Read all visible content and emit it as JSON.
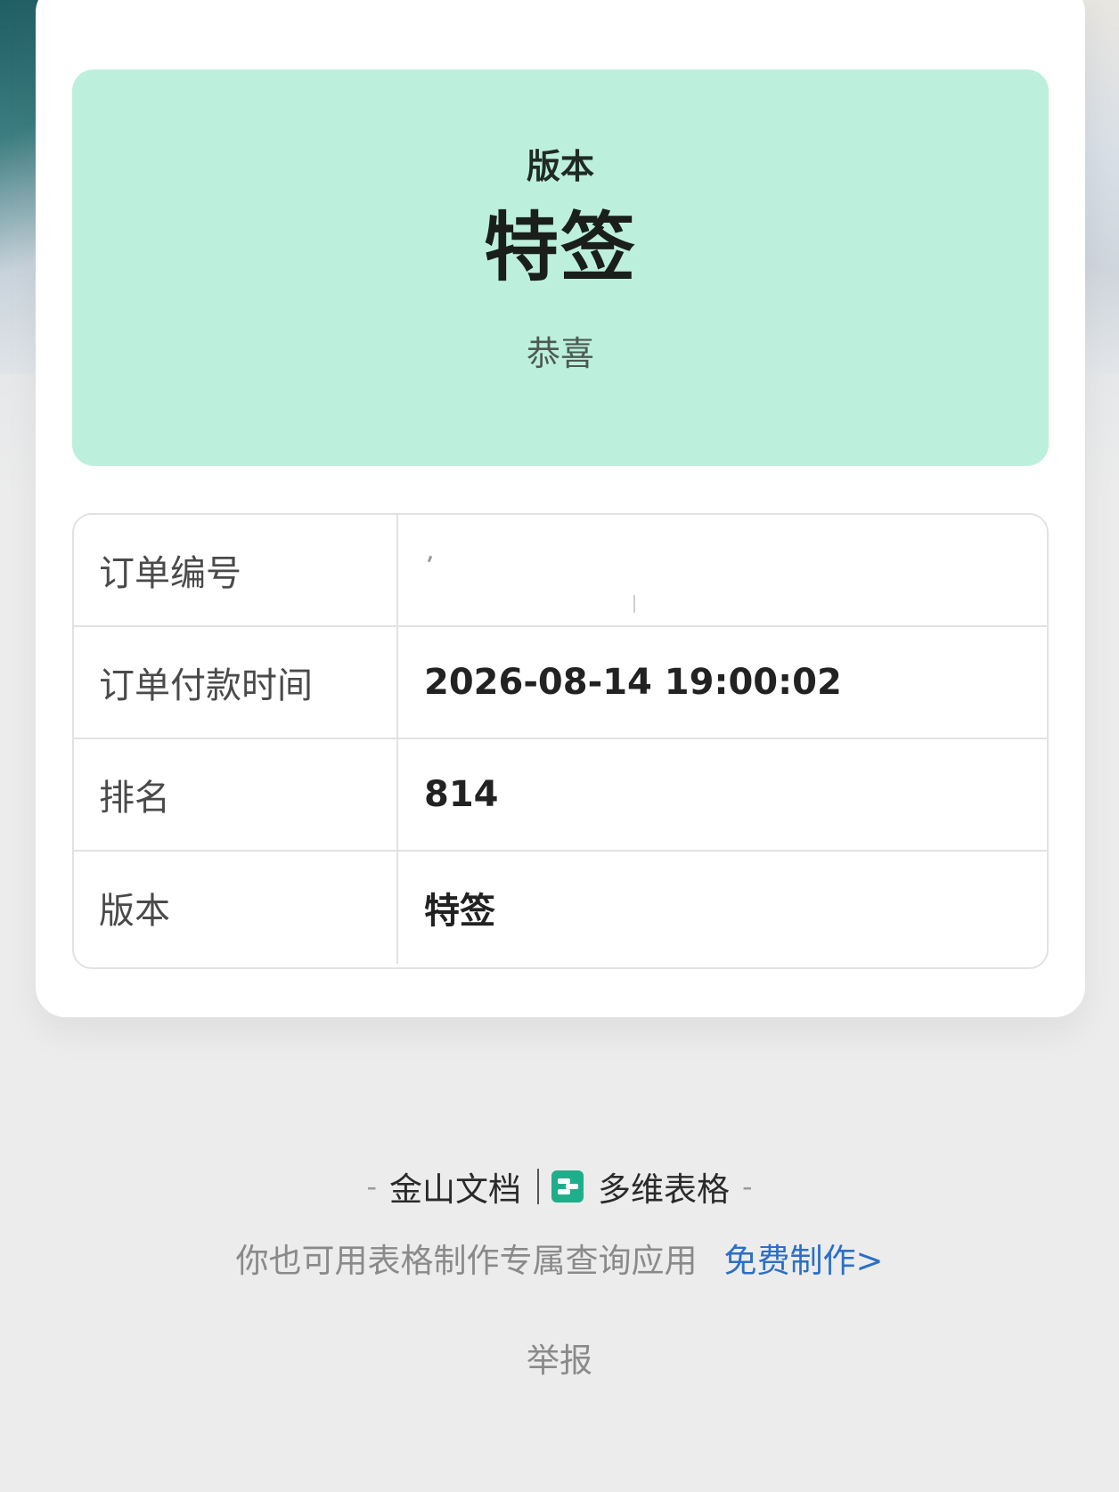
{
  "hero": {
    "label": "版本",
    "value": "特签",
    "subtitle": "恭喜"
  },
  "order_table": {
    "rows": [
      {
        "key": "订单编号",
        "value": ""
      },
      {
        "key": "订单付款时间",
        "value": "2026-08-14 19:00:02"
      },
      {
        "key": "排名",
        "value": "814"
      },
      {
        "key": "版本",
        "value": "特签"
      }
    ]
  },
  "footer": {
    "left_dash": "-",
    "brand": "金山文档",
    "product": "多维表格",
    "right_dash": "-",
    "promo_text": "你也可用表格制作专属查询应用",
    "promo_link": "免费制作>",
    "report": "举报"
  },
  "colors": {
    "hero_bg": "#bcf0dc",
    "link": "#2b6fc7",
    "product_icon": "#1fae8a"
  },
  "icons": {
    "product_icon": "multidimensional-table-icon"
  }
}
